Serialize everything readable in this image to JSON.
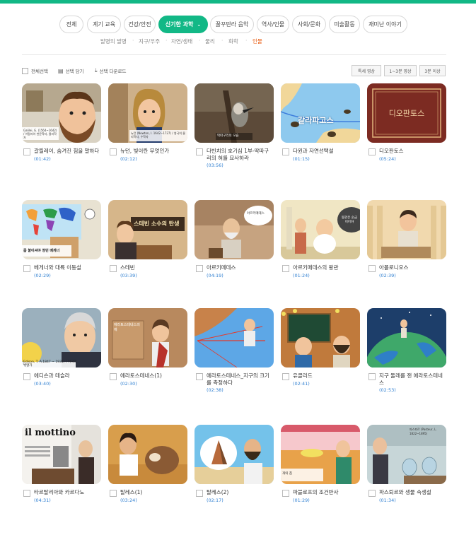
{
  "categories": [
    {
      "label": "전체",
      "active": false
    },
    {
      "label": "계기 교육",
      "active": false
    },
    {
      "label": "건강/안전",
      "active": false
    },
    {
      "label": "신기한 과학",
      "active": true
    },
    {
      "label": "꿀꾸딴라 음악",
      "active": false
    },
    {
      "label": "역사/인물",
      "active": false
    },
    {
      "label": "사회/문화",
      "active": false
    },
    {
      "label": "미술활동",
      "active": false
    },
    {
      "label": "재미난 이야기",
      "active": false
    }
  ],
  "subcategories": [
    {
      "label": "발명의 발명",
      "active": false
    },
    {
      "label": "지구/우주",
      "active": false
    },
    {
      "label": "자연/생태",
      "active": false
    },
    {
      "label": "물리",
      "active": false
    },
    {
      "label": "화학",
      "active": false
    },
    {
      "label": "인물",
      "active": true
    }
  ],
  "toolbar": {
    "select_all": "전체선택",
    "save_selected": "선택 담기",
    "download_selected": "선택 다운로드",
    "filters": [
      "특세 영상",
      "1~3분 영상",
      "3분 이상"
    ]
  },
  "videos": [
    {
      "title": "갈릴레이, 숨겨진 힘을 말하다",
      "duration": "(01:42)",
      "caption": "Galilei, G. (1564~1642) / 이탈리아 천문학자, 물리학자"
    },
    {
      "title": "뉴턴, 빛이란 무엇인가",
      "duration": "(02:12)",
      "caption": "뉴턴 (Newton, I. 1642~1727) / 영국의 물리학자, 수학자"
    },
    {
      "title": "다빈치의 호기심 1부-딱따구리의 혀를 묘사하라",
      "duration": "(03:56)",
      "caption": "딱따구리의 모습"
    },
    {
      "title": "다윈과 자연선택설",
      "duration": "(01:15)",
      "caption": "갈라파고스"
    },
    {
      "title": "디오판토스",
      "duration": "(05:24)",
      "caption": "디오판토스"
    },
    {
      "title": "베게너와 대륙 이동설",
      "duration": "(02:29)",
      "caption": "좀 붙이셔야 정민 베게너"
    },
    {
      "title": "스테빈",
      "duration": "(03:39)",
      "caption": "스테빈 소수의 탄생"
    },
    {
      "title": "아르키메데스",
      "duration": "(04:19)",
      "caption": "아르키메데스"
    },
    {
      "title": "아르키메데스의 왕관",
      "duration": "(01:24)",
      "caption": "왕관은 순금이어야"
    },
    {
      "title": "아폴로니오스",
      "duration": "(02:39)",
      "caption": ""
    },
    {
      "title": "에디슨과 테슬라",
      "duration": "(03:40)",
      "caption": "Edison, T. A.1847 ~ 1931) / 미국의 발명가"
    },
    {
      "title": "에라토스테네스(1)",
      "duration": "(02:30)",
      "caption": "에라토스테네스의 체"
    },
    {
      "title": "에라토스테네스_지구의 크기를 측정하다",
      "duration": "(02:38)",
      "caption": ""
    },
    {
      "title": "유클리드",
      "duration": "(02:41)",
      "caption": ""
    },
    {
      "title": "지구 둘레를 잰 에라토스테네스",
      "duration": "(02:53)",
      "caption": ""
    },
    {
      "title": "타르탈리아와 카르다노",
      "duration": "(04:31)",
      "caption": "il mottino"
    },
    {
      "title": "탈레스(1)",
      "duration": "(03:24)",
      "caption": ""
    },
    {
      "title": "탈레스(2)",
      "duration": "(02:17)",
      "caption": ""
    },
    {
      "title": "파블로프의 조건반사",
      "duration": "(01:29)",
      "caption": "개의 침"
    },
    {
      "title": "파스퇴르와 생물 속생설",
      "duration": "(01:34)",
      "caption": "파스퇴르 (Pasteur, L. 1822~1895)"
    }
  ]
}
